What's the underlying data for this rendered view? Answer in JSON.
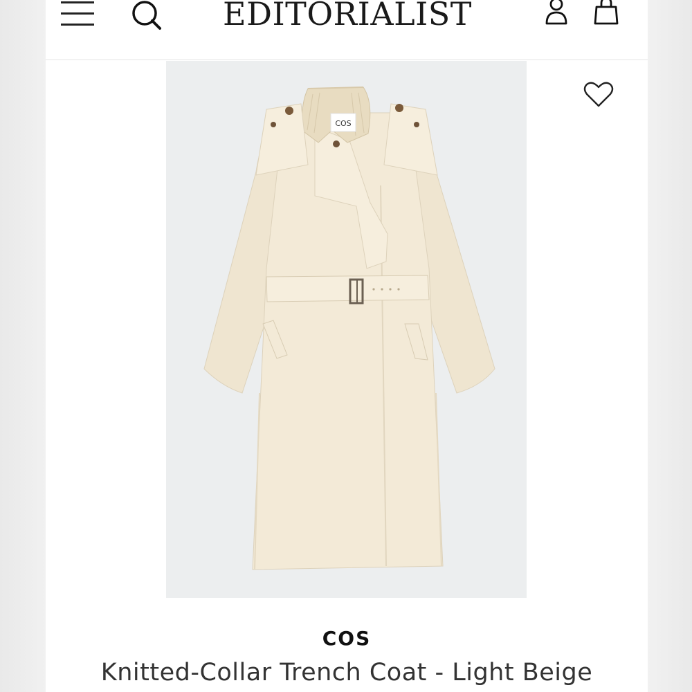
{
  "header": {
    "logo": "EDITORIALIST",
    "icons": [
      "menu-icon",
      "search-icon",
      "account-icon",
      "bag-icon"
    ]
  },
  "product": {
    "brand": "COS",
    "title": "Knitted-Collar Trench Coat - Light Beige",
    "label_tag": "COS",
    "wishlist_icon": "heart-icon",
    "image_background": "#eceeef",
    "coat_color": "#f3ead7"
  }
}
